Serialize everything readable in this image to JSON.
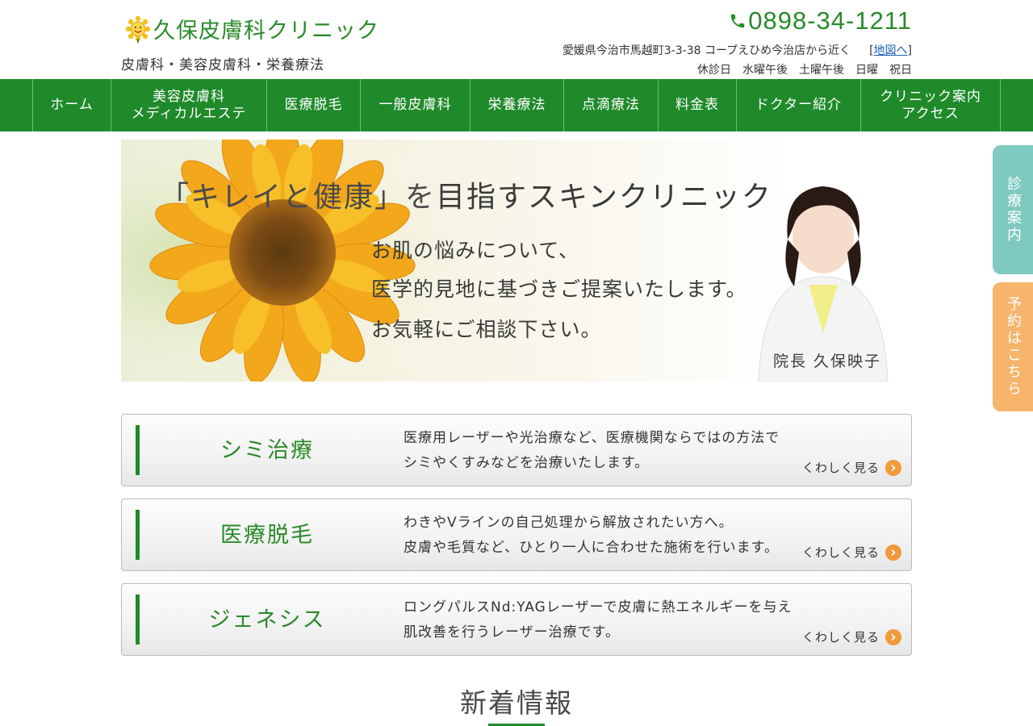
{
  "header": {
    "logo_text": "久保皮膚科クリニック",
    "tagline": "皮膚科・美容皮膚科・栄養療法",
    "phone": "0898-34-1211",
    "address": "愛媛県今治市馬越町3-3-38 コープえひめ今治店から近く",
    "map_link_open": "[",
    "map_link": "地図へ",
    "map_link_close": "]",
    "holidays": "休診日　水曜午後　土曜午後　日曜　祝日"
  },
  "nav": {
    "items": [
      {
        "label": "ホーム"
      },
      {
        "label": "美容皮膚科\nメディカルエステ"
      },
      {
        "label": "医療脱毛"
      },
      {
        "label": "一般皮膚科"
      },
      {
        "label": "栄養療法"
      },
      {
        "label": "点滴療法"
      },
      {
        "label": "料金表"
      },
      {
        "label": "ドクター紹介"
      },
      {
        "label": "クリニック案内\nアクセス"
      }
    ]
  },
  "hero": {
    "title_a": "「キレイと健康」を",
    "title_b": "目指すスキンクリニック",
    "lines": [
      "お肌の悩みについて、",
      "医学的見地に基づきご提案いたします。",
      "お気軽にご相談下さい。"
    ],
    "caption": "院長 久保映子"
  },
  "services": [
    {
      "title": "シミ治療",
      "desc1": "医療用レーザーや光治療など、医療機関ならではの方法で",
      "desc2": "シミやくすみなどを治療いたします。",
      "more": "くわしく見る"
    },
    {
      "title": "医療脱毛",
      "desc1": "わきやVラインの自己処理から解放されたい方へ。",
      "desc2": "皮膚や毛質など、ひとり一人に合わせた施術を行います。",
      "more": "くわしく見る"
    },
    {
      "title": "ジェネシス",
      "desc1": "ロングパルスNd:YAGレーザーで皮膚に熱エネルギーを与え",
      "desc2": "肌改善を行うレーザー治療です。",
      "more": "くわしく見る"
    }
  ],
  "news": {
    "title": "新着情報"
  },
  "side_tabs": {
    "tab1": "診療案内",
    "tab2": "予約はこちら"
  },
  "colors": {
    "brand_green": "#1f8a2a",
    "accent_orange": "#f19a3a",
    "tab_teal": "#7ec9c0",
    "tab_orange": "#f6b56b"
  }
}
